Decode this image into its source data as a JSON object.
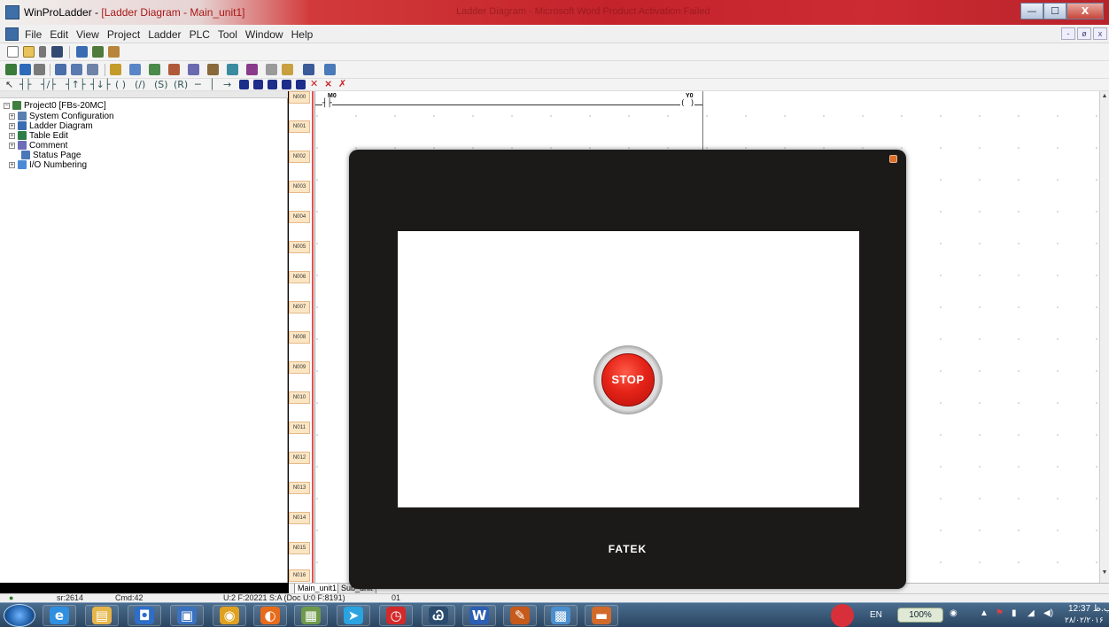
{
  "window": {
    "app_name": "WinProLadder",
    "doc_title": "[Ladder Diagram - Main_unit1]",
    "background_title": "Ladder Diagram - Microsoft Word Product Activation Failed",
    "buttons": {
      "minimize": "—",
      "maximize": "☐",
      "close": "X"
    }
  },
  "menubar": {
    "items": [
      "File",
      "Edit",
      "View",
      "Project",
      "Ladder",
      "PLC",
      "Tool",
      "Window",
      "Help"
    ],
    "mdi_buttons": [
      "-",
      "ø",
      "x"
    ]
  },
  "tree": {
    "root": "Project0 [FBs-20MC]",
    "items": [
      {
        "label": "System Configuration",
        "icon": "config-icon",
        "color": "#5a7fb0"
      },
      {
        "label": "Ladder Diagram",
        "icon": "ladder-icon",
        "color": "#3a6cb4"
      },
      {
        "label": "Table Edit",
        "icon": "table-icon",
        "color": "#2d7d46"
      },
      {
        "label": "Comment",
        "icon": "comment-icon",
        "color": "#6d6db8"
      },
      {
        "label": "Status Page",
        "icon": "status-icon",
        "color": "#4a78b8"
      },
      {
        "label": "I/O Numbering",
        "icon": "io-icon",
        "color": "#4b8ad6"
      }
    ]
  },
  "ladder": {
    "row_labels": [
      "N000",
      "N001",
      "N002",
      "N003",
      "N004",
      "N005",
      "N006",
      "N007",
      "N008",
      "N009",
      "N010",
      "N011",
      "N012",
      "N013",
      "N014",
      "N015",
      "N016"
    ],
    "contact_label": "M0",
    "contact_symbol": "┤├",
    "coil_label": "Y0",
    "coil_symbol": "( )"
  },
  "sheet_tabs": [
    "Main_unit1",
    "Sub_unit"
  ],
  "statusbar": {
    "sr": "sr:2614",
    "cmd": "Cmd:42",
    "memory": "U:2 F:20221 S:A (Doc U:0 F:8191)",
    "station": "01"
  },
  "hmi": {
    "stop_label": "STOP",
    "brand": "FATEK",
    "screen_color": "#ffffff",
    "bezel_color": "#1c1a19"
  },
  "taskbar": {
    "apps": [
      {
        "name": "ie-icon",
        "glyph": "e",
        "color": "#2f8fe0"
      },
      {
        "name": "explorer-icon",
        "glyph": "▤",
        "color": "#e6b64a"
      },
      {
        "name": "outlook-icon",
        "glyph": "◘",
        "color": "#2e6ec8"
      },
      {
        "name": "media-icon",
        "glyph": "▣",
        "color": "#3a72c0"
      },
      {
        "name": "chrome-icon",
        "glyph": "◉",
        "color": "#e0a020"
      },
      {
        "name": "firefox-icon",
        "glyph": "◐",
        "color": "#e86b1a"
      },
      {
        "name": "picture-icon",
        "glyph": "▦",
        "color": "#6f9a4a"
      },
      {
        "name": "telegram-icon",
        "glyph": "➤",
        "color": "#2aa3e0"
      },
      {
        "name": "timer-icon",
        "glyph": "◷",
        "color": "#d22a2a"
      },
      {
        "name": "winproladder-icon",
        "glyph": "Ꮚ",
        "color": "#2b4c6e"
      },
      {
        "name": "word-icon",
        "glyph": "W",
        "color": "#2b5fb4"
      },
      {
        "name": "tool-icon",
        "glyph": "✎",
        "color": "#c65a1a"
      },
      {
        "name": "network-app-icon",
        "glyph": "▩",
        "color": "#4b8fcf"
      },
      {
        "name": "presentation-icon",
        "glyph": "▬",
        "color": "#d26a2a"
      }
    ],
    "language": "EN",
    "zoom": "100%",
    "time": "12:37 ب.ظ",
    "date": "۲۸/۰۲/۲۰۱۶"
  }
}
